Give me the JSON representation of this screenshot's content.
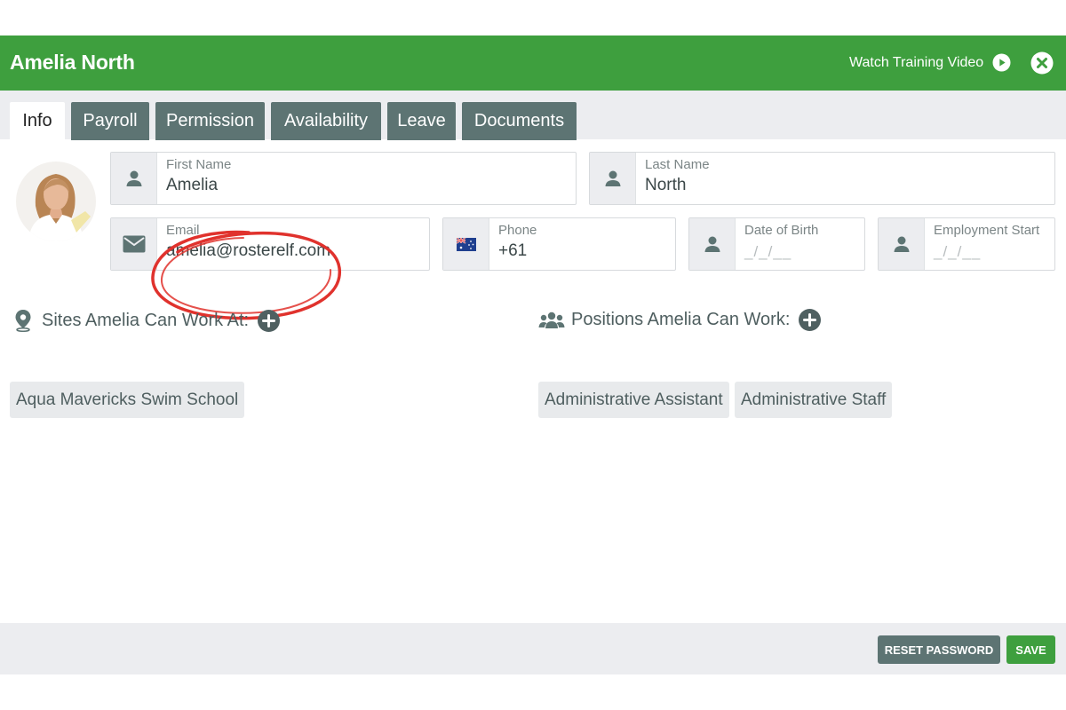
{
  "header": {
    "title": "Amelia North",
    "watch_label": "Watch Training Video",
    "play_icon": "play-circle-icon",
    "close_icon": "close-circle-icon",
    "color": "#3e9f3e"
  },
  "tabs": [
    {
      "label": "Info",
      "active": true
    },
    {
      "label": "Payroll",
      "active": false
    },
    {
      "label": "Permission",
      "active": false
    },
    {
      "label": "Availability",
      "active": false
    },
    {
      "label": "Leave",
      "active": false
    },
    {
      "label": "Documents",
      "active": false
    }
  ],
  "form": {
    "first_name": {
      "label": "First Name",
      "value": "Amelia",
      "icon": "person-icon"
    },
    "last_name": {
      "label": "Last Name",
      "value": "North",
      "icon": "person-icon"
    },
    "email": {
      "label": "Email",
      "value": "amelia@rosterelf.com",
      "icon": "envelope-icon"
    },
    "phone": {
      "label": "Phone",
      "value": "+61",
      "icon": "australia-flag-icon"
    },
    "dob": {
      "label": "Date of Birth",
      "placeholder": "_/_/__",
      "icon": "person-icon"
    },
    "employment_start": {
      "label": "Employment Start",
      "placeholder": "_/_/__",
      "icon": "person-icon"
    }
  },
  "sites": {
    "title": "Sites Amelia Can Work At:",
    "icon": "map-pin-icon",
    "items": [
      "Aqua Mavericks Swim School"
    ]
  },
  "positions": {
    "title": "Positions Amelia Can Work:",
    "icon": "users-icon",
    "items": [
      "Administrative Assistant",
      "Administrative Staff"
    ]
  },
  "footer": {
    "reset_label": "RESET PASSWORD",
    "save_label": "SAVE"
  }
}
